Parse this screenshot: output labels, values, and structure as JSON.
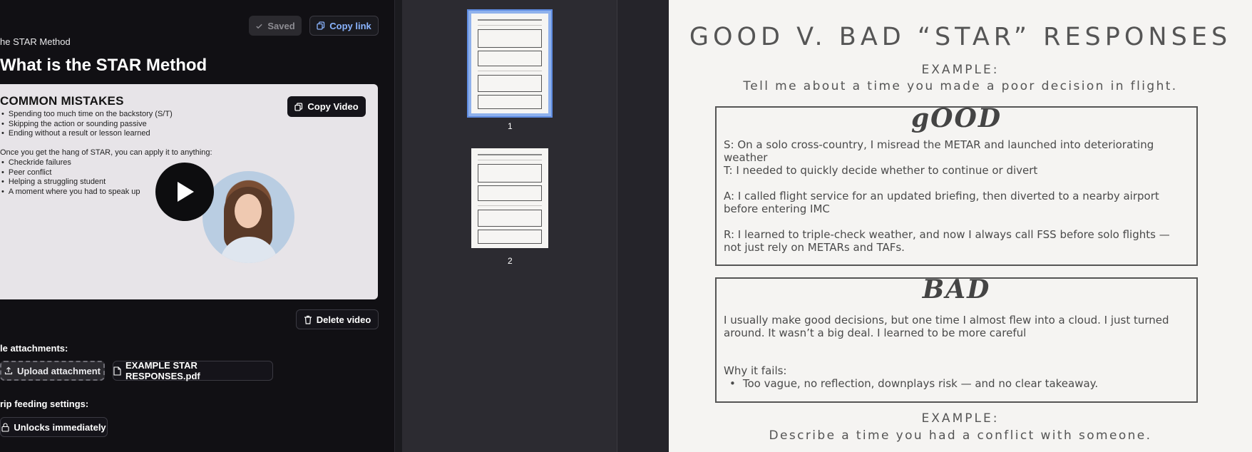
{
  "editor": {
    "saved_label": "Saved",
    "copy_link_label": "Copy link",
    "breadcrumb": "he STAR Method",
    "title": "What is the STAR Method",
    "video": {
      "heading": "COMMON MISTAKES",
      "mistakes": [
        "Spending too much time on the backstory (S/T)",
        "Skipping the action or sounding passive",
        "Ending without a result or lesson learned"
      ],
      "subheading": "Once you get the hang of STAR, you can apply it to anything:",
      "examples": [
        "Checkride failures",
        "Peer conflict",
        "Helping a struggling student",
        "A moment where you had to speak up"
      ],
      "copy_video_label": "Copy Video"
    },
    "delete_video_label": "Delete video",
    "attachments_label": "le attachments:",
    "upload_label": "Upload attachment",
    "file_name": "EXAMPLE STAR RESPONSES.pdf",
    "drip_label": "rip feeding settings:",
    "unlock_label": "Unlocks immediately"
  },
  "thumbnails": [
    {
      "page": "1",
      "selected": true
    },
    {
      "page": "2",
      "selected": false
    }
  ],
  "pdf_page": {
    "title": "GOOD V. BAD “STAR” RESPONSES",
    "example1_label": "EXAMPLE:",
    "example1_question": "Tell me about a time you made a poor decision in flight.",
    "good_heading": "gOOD",
    "good_lines": [
      "S: On a solo cross-country, I misread the METAR and launched into deteriorating weather",
      "T: I needed to quickly decide whether to continue or divert",
      "A: I called flight service for an updated briefing, then diverted to a nearby airport before entering IMC",
      "R: I learned to triple-check weather, and now I always call FSS before solo flights — not just rely on METARs and TAFs."
    ],
    "bad_heading": "BAD",
    "bad_text": "I usually make good decisions, but one time I almost flew into a cloud. I just turned around. It wasn’t a big deal. I learned to be more careful",
    "why_fails_label": "Why it fails:",
    "why_fails_items": [
      "Too vague, no reflection, downplays risk — and no clear takeaway."
    ],
    "example2_label": "EXAMPLE:",
    "example2_question": "Describe a time you had a conflict with someone."
  },
  "colors": {
    "editor_bg": "#111014",
    "accent_link": "#8ab4ff",
    "thumb_selected": "#8fb1ec",
    "pdf_bg": "#f5f4f2"
  }
}
